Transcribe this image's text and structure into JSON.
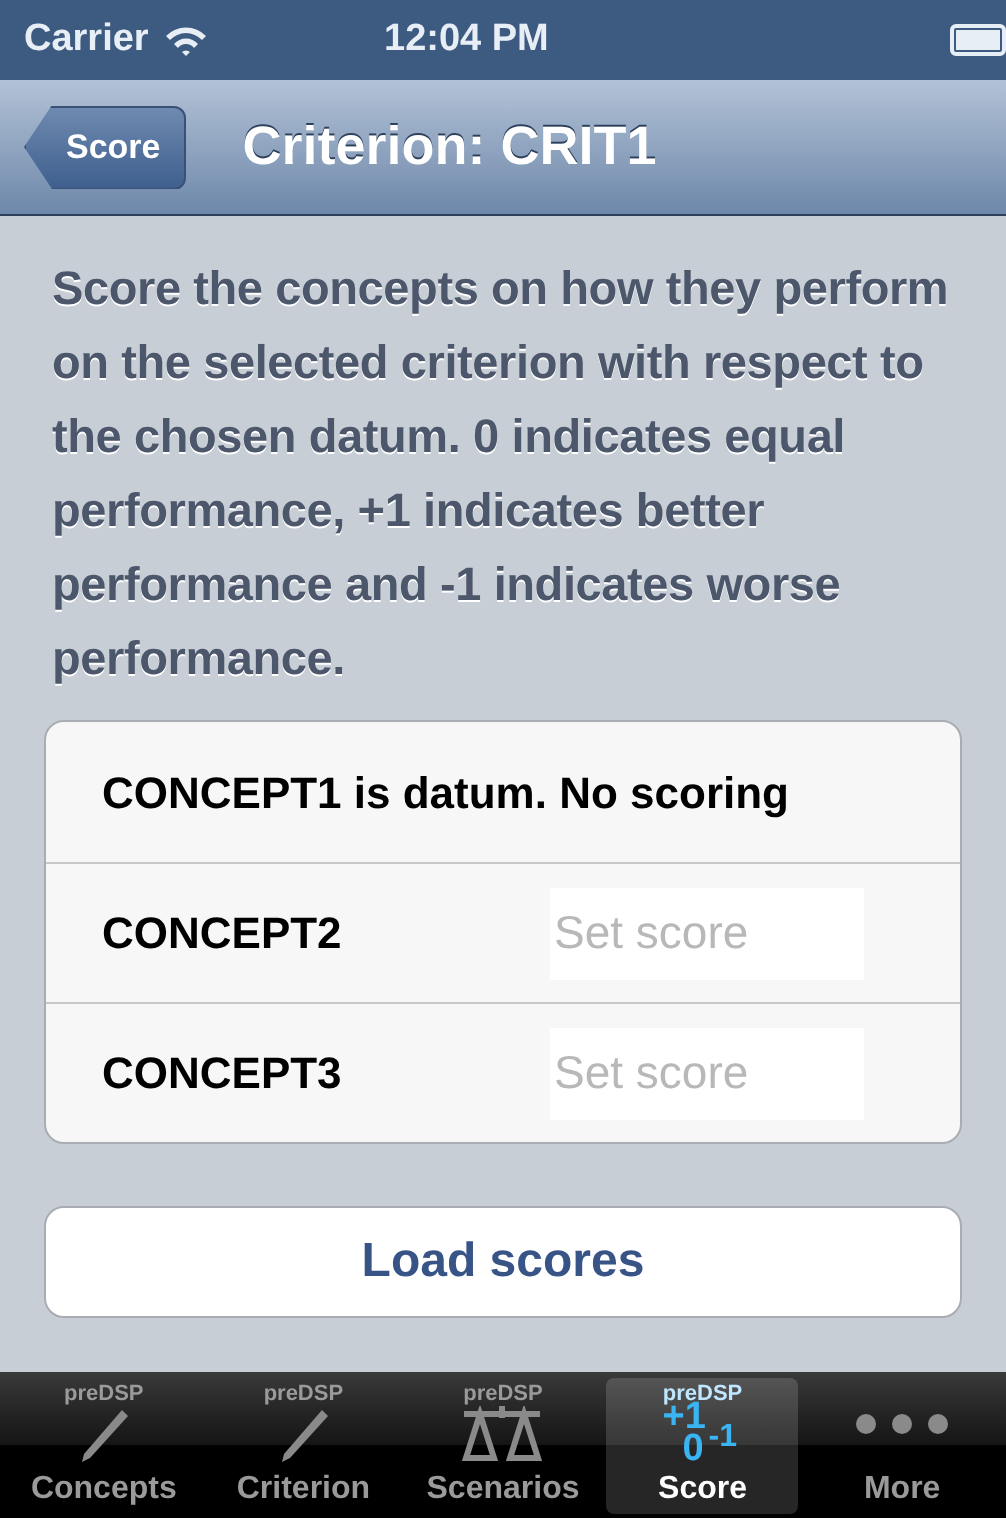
{
  "status_bar": {
    "carrier": "Carrier",
    "time": "12:04 PM"
  },
  "nav": {
    "back": "Score",
    "title": "Criterion: CRIT1"
  },
  "instructions": "Score the concepts on how they perform on the selected criterion with respect to the chosen datum. 0 indicates equal performance, +1 indicates better performance and -1 indicates worse performance.",
  "rows": [
    {
      "kind": "note",
      "label": "CONCEPT1 is datum. No scoring"
    },
    {
      "kind": "score",
      "label": "CONCEPT2",
      "placeholder": "Set score"
    },
    {
      "kind": "score",
      "label": "CONCEPT3",
      "placeholder": "Set score"
    }
  ],
  "load_button": "Load scores",
  "tabs": [
    {
      "kind": "pencil",
      "badge": "preDSP",
      "label": "Concepts",
      "selected": false
    },
    {
      "kind": "pencil",
      "badge": "preDSP",
      "label": "Criterion",
      "selected": false
    },
    {
      "kind": "scales",
      "badge": "preDSP",
      "label": "Scenarios",
      "selected": false
    },
    {
      "kind": "score",
      "badge": "preDSP",
      "label": "Score",
      "selected": true,
      "glyphs": [
        "+1",
        "0",
        "-1"
      ]
    },
    {
      "kind": "more",
      "label": "More",
      "selected": false
    }
  ]
}
